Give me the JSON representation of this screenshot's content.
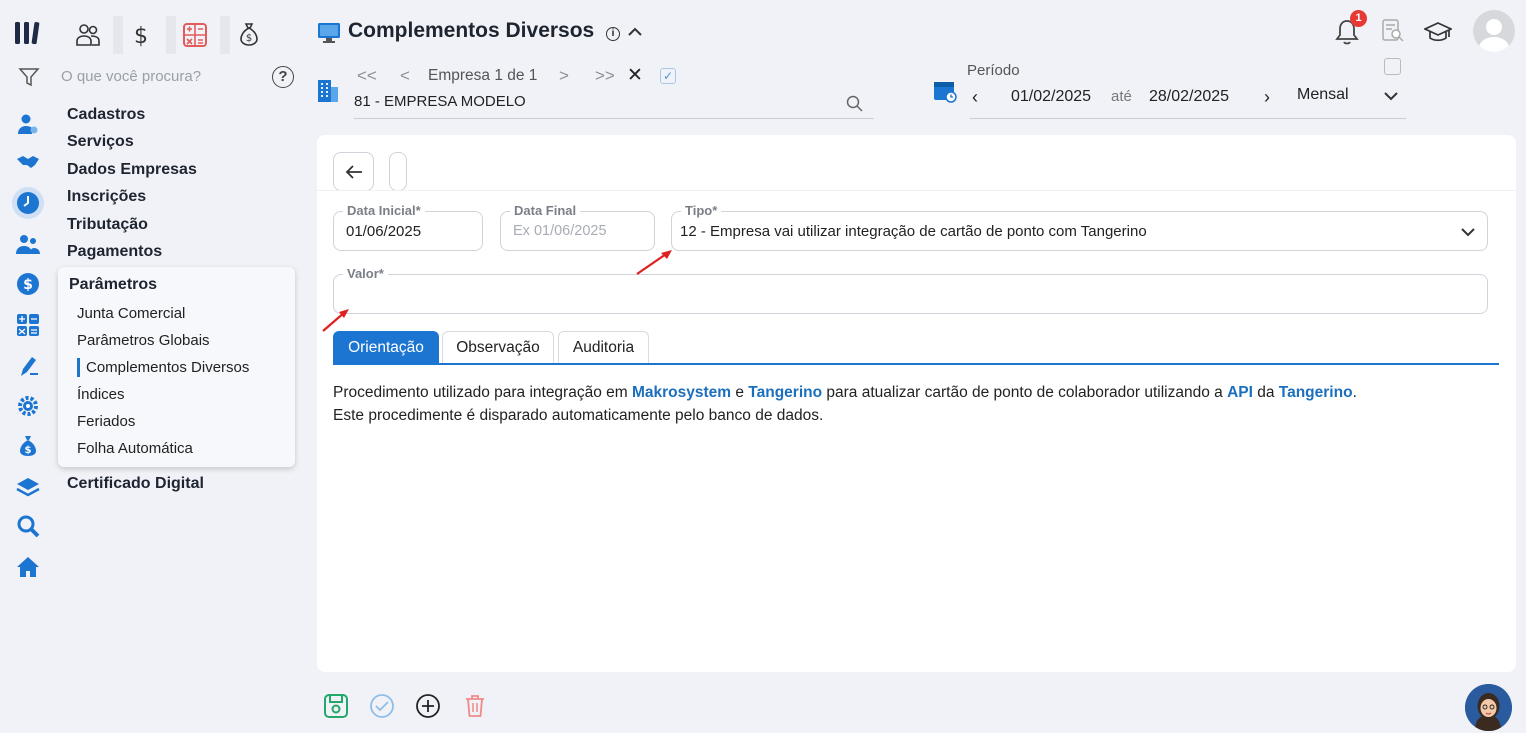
{
  "app": {
    "search_placeholder": "O que você procura?",
    "help_label": "?"
  },
  "header": {
    "title": "Complementos Diversos",
    "info_label": "i"
  },
  "empresa": {
    "first": "<<",
    "prev": "<",
    "pager": "Empresa 1 de 1",
    "next": ">",
    "last": ">>",
    "clear": "✕",
    "check": "✓",
    "value": "81 - EMPRESA MODELO"
  },
  "periodo": {
    "label": "Período",
    "prev": "‹",
    "from": "01/02/2025",
    "ate": "até",
    "to": "28/02/2025",
    "next": "›",
    "mode": "Mensal"
  },
  "notifications": {
    "count": "1"
  },
  "menu": {
    "items": [
      "Cadastros",
      "Serviços",
      "Dados Empresas",
      "Inscrições",
      "Tributação",
      "Pagamentos"
    ],
    "section_title": "Parâmetros",
    "subitems": [
      "Junta Comercial",
      "Parâmetros Globais",
      "Complementos Diversos",
      "Índices",
      "Feriados",
      "Folha Automática"
    ],
    "after": "Certificado Digital"
  },
  "form": {
    "data_inicial": {
      "label": "Data Inicial*",
      "value": "01/06/2025"
    },
    "data_final": {
      "label": "Data Final",
      "placeholder": "Ex 01/06/2025"
    },
    "tipo": {
      "label": "Tipo*",
      "value": "12 - Empresa vai utilizar integração de cartão de ponto com Tangerino"
    },
    "valor": {
      "label": "Valor*",
      "value": ""
    }
  },
  "tabs": [
    "Orientação",
    "Observação",
    "Auditoria"
  ],
  "orientacao": {
    "line1_a": "Procedimento utilizado para integração em ",
    "line1_b": "Makrosystem",
    "line1_c": " e ",
    "line1_d": "Tangerino",
    "line1_e": " para atualizar cartão de ponto de colaborador utilizando a ",
    "line1_f": "API",
    "line1_g": " da ",
    "line1_h": "Tangerino",
    "line1_i": ".",
    "line2": "Este procedimente é disparado automaticamente pelo banco de dados."
  },
  "colors": {
    "accent": "#1b75d1",
    "link": "#1b6fbd",
    "badge": "#e53935",
    "save": "#22a86b",
    "delete": "#f08a8a"
  },
  "icons": {
    "rail": [
      "user-gear-icon",
      "handshake-icon",
      "clock-icon",
      "users-icon",
      "dollar-circle-icon",
      "calculator-icon",
      "pen-icon",
      "gear-icon",
      "money-bag-icon",
      "layers-icon",
      "search-icon",
      "home-icon"
    ],
    "modules": [
      "people-icon",
      "dollar-icon",
      "calculator-icon",
      "money-bag-icon"
    ]
  }
}
